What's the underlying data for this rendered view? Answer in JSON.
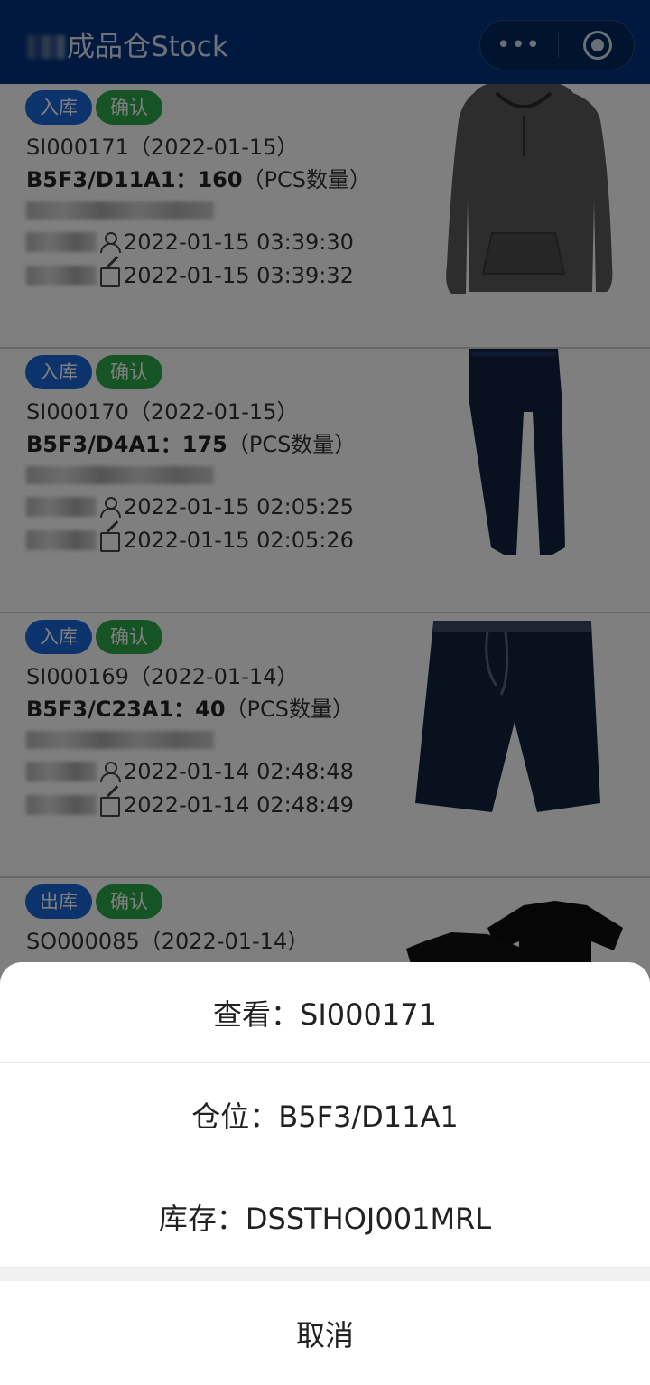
{
  "header": {
    "title": "成品仓Stock"
  },
  "cards": [
    {
      "tag_type": "入库",
      "tag_status": "确认",
      "order": "SI000171（2022-01-15）",
      "location_qty": "B5F3/D11A1：160",
      "unit": "（PCS数量）",
      "created_time": "2022-01-15 03:39:30",
      "updated_time": "2022-01-15 03:39:32",
      "product": "hoodie"
    },
    {
      "tag_type": "入库",
      "tag_status": "确认",
      "order": "SI000170（2022-01-15）",
      "location_qty": "B5F3/D4A1：175",
      "unit": "（PCS数量）",
      "created_time": "2022-01-15 02:05:25",
      "updated_time": "2022-01-15 02:05:26",
      "product": "pants"
    },
    {
      "tag_type": "入库",
      "tag_status": "确认",
      "order": "SI000169（2022-01-14）",
      "location_qty": "B5F3/C23A1：40",
      "unit": "（PCS数量）",
      "created_time": "2022-01-14 02:48:48",
      "updated_time": "2022-01-14 02:48:49",
      "product": "shorts"
    },
    {
      "tag_type": "出库",
      "tag_status": "确认",
      "order": "SO000085（2022-01-14）",
      "product": "t-shirts"
    }
  ],
  "sheet": {
    "view": "查看：SI000171",
    "location": "仓位：B5F3/D11A1",
    "stock": "库存：DSSTHOJ001MRL",
    "cancel": "取消"
  },
  "colors": {
    "header_bg": "#02337f",
    "tag_in": "#1a66d9",
    "tag_out": "#1a66d9",
    "tag_confirm": "#2ea84a"
  }
}
